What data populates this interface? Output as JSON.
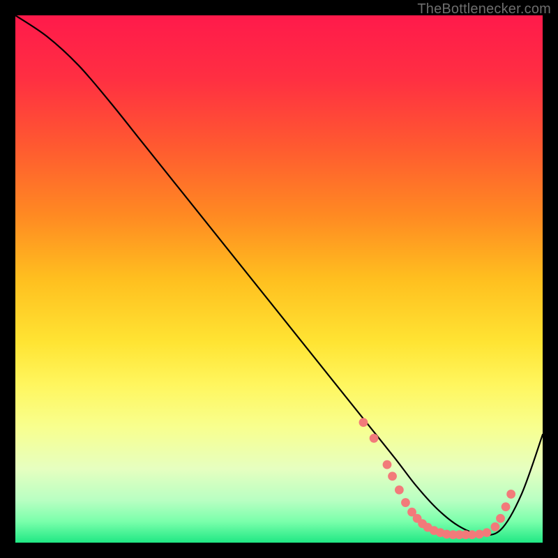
{
  "watermark": "TheBottlenecker.com",
  "chart_data": {
    "type": "line",
    "title": "",
    "xlabel": "",
    "ylabel": "",
    "xlim": [
      0,
      100
    ],
    "ylim": [
      0,
      100
    ],
    "grid": false,
    "background_gradient": {
      "stops": [
        {
          "offset": 0,
          "color": "#ff1a4b"
        },
        {
          "offset": 12,
          "color": "#ff2f42"
        },
        {
          "offset": 25,
          "color": "#ff5a30"
        },
        {
          "offset": 38,
          "color": "#ff8a22"
        },
        {
          "offset": 50,
          "color": "#ffbf1f"
        },
        {
          "offset": 62,
          "color": "#ffe433"
        },
        {
          "offset": 70,
          "color": "#fff65e"
        },
        {
          "offset": 78,
          "color": "#f8ff8e"
        },
        {
          "offset": 86,
          "color": "#e6ffc0"
        },
        {
          "offset": 92,
          "color": "#b8ffc2"
        },
        {
          "offset": 96,
          "color": "#7affab"
        },
        {
          "offset": 100,
          "color": "#20e884"
        }
      ]
    },
    "series": [
      {
        "name": "bottleneck-curve",
        "color": "#000000",
        "width": 2.2,
        "x": [
          0,
          6,
          12,
          18,
          24,
          30,
          36,
          42,
          48,
          54,
          60,
          66,
          72,
          76,
          80,
          84,
          88,
          92,
          96,
          100
        ],
        "y": [
          100,
          96,
          90.5,
          83.5,
          76,
          68.5,
          61,
          53.5,
          46,
          38.5,
          31,
          23.5,
          16,
          10.8,
          6.4,
          3.2,
          1.6,
          2.4,
          9.2,
          20.5
        ]
      }
    ],
    "markers": {
      "name": "highlight-dots",
      "color": "#f27a7a",
      "radius": 6.4,
      "points": [
        {
          "x": 66.0,
          "y": 22.8
        },
        {
          "x": 68.0,
          "y": 19.8
        },
        {
          "x": 70.5,
          "y": 14.8
        },
        {
          "x": 71.5,
          "y": 12.6
        },
        {
          "x": 72.8,
          "y": 10.0
        },
        {
          "x": 74.0,
          "y": 7.6
        },
        {
          "x": 75.2,
          "y": 5.8
        },
        {
          "x": 76.2,
          "y": 4.6
        },
        {
          "x": 77.2,
          "y": 3.6
        },
        {
          "x": 78.2,
          "y": 2.9
        },
        {
          "x": 79.4,
          "y": 2.3
        },
        {
          "x": 80.6,
          "y": 1.9
        },
        {
          "x": 81.8,
          "y": 1.6
        },
        {
          "x": 83.0,
          "y": 1.5
        },
        {
          "x": 84.2,
          "y": 1.5
        },
        {
          "x": 85.4,
          "y": 1.5
        },
        {
          "x": 86.6,
          "y": 1.5
        },
        {
          "x": 88.0,
          "y": 1.6
        },
        {
          "x": 89.4,
          "y": 1.9
        },
        {
          "x": 91.0,
          "y": 3.0
        },
        {
          "x": 92.0,
          "y": 4.6
        },
        {
          "x": 93.0,
          "y": 6.8
        },
        {
          "x": 94.0,
          "y": 9.2
        }
      ]
    }
  }
}
